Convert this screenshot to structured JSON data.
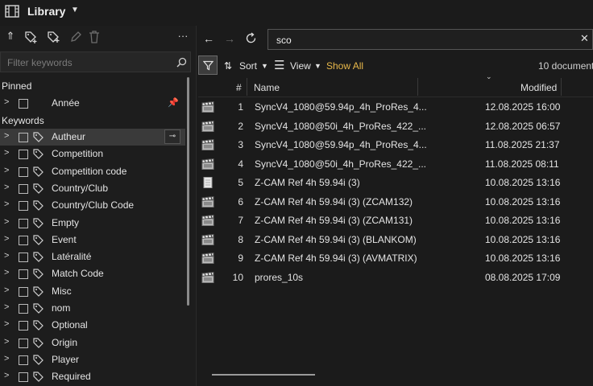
{
  "app": {
    "title": "Library"
  },
  "left": {
    "filter_placeholder": "Filter keywords",
    "pinned_header": "Pinned",
    "pinned_items": [
      {
        "label": "Année"
      }
    ],
    "keywords_header": "Keywords",
    "keywords": [
      {
        "label": "Autheur",
        "highlighted": true
      },
      {
        "label": "Competition"
      },
      {
        "label": "Competition code"
      },
      {
        "label": "Country/Club"
      },
      {
        "label": "Country/Club Code"
      },
      {
        "label": "Empty"
      },
      {
        "label": "Event"
      },
      {
        "label": "Latéralité"
      },
      {
        "label": "Match Code"
      },
      {
        "label": "Misc"
      },
      {
        "label": "nom"
      },
      {
        "label": "Optional"
      },
      {
        "label": "Origin"
      },
      {
        "label": "Player"
      },
      {
        "label": "Required"
      }
    ]
  },
  "right": {
    "search_value": "sco",
    "toolbar": {
      "sort_label": "Sort",
      "view_label": "View",
      "show_all_label": "Show All",
      "doc_count": "10 document"
    },
    "columns": {
      "num": "#",
      "name": "Name",
      "modified": "Modified"
    },
    "files": [
      {
        "num": "1",
        "name": "SyncV4_1080@59.94p_4h_ProRes_4...",
        "modified": "12.08.2025 16:00",
        "icon": "video-clapper-icon"
      },
      {
        "num": "2",
        "name": "SyncV4_1080@50i_4h_ProRes_422_...",
        "modified": "12.08.2025 06:57",
        "icon": "video-clapper-icon"
      },
      {
        "num": "3",
        "name": "SyncV4_1080@59.94p_4h_ProRes_4...",
        "modified": "11.08.2025 21:37",
        "icon": "video-clapper-icon"
      },
      {
        "num": "4",
        "name": "SyncV4_1080@50i_4h_ProRes_422_...",
        "modified": "11.08.2025 08:11",
        "icon": "video-clapper-icon"
      },
      {
        "num": "5",
        "name": "Z-CAM Ref 4h 59.94i (3)",
        "modified": "10.08.2025 13:16",
        "icon": "document-icon"
      },
      {
        "num": "6",
        "name": "Z-CAM Ref 4h 59.94i (3) (ZCAM132)",
        "modified": "10.08.2025 13:16",
        "icon": "video-clapper-icon"
      },
      {
        "num": "7",
        "name": "Z-CAM Ref 4h 59.94i (3) (ZCAM131)",
        "modified": "10.08.2025 13:16",
        "icon": "video-clapper-icon"
      },
      {
        "num": "8",
        "name": "Z-CAM Ref 4h 59.94i (3) (BLANKOM)",
        "modified": "10.08.2025 13:16",
        "icon": "video-clapper-icon"
      },
      {
        "num": "9",
        "name": "Z-CAM Ref 4h 59.94i (3) (AVMATRIX)",
        "modified": "10.08.2025 13:16",
        "icon": "video-clapper-icon"
      },
      {
        "num": "10",
        "name": "prores_10s",
        "modified": "08.08.2025 17:09",
        "icon": "video-clapper-icon"
      }
    ]
  }
}
